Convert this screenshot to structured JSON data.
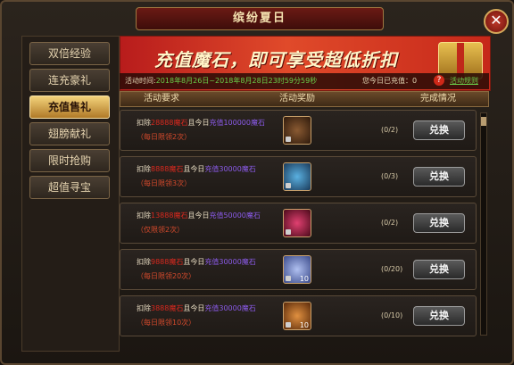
{
  "window": {
    "title": "缤纷夏日",
    "close_label": "✕"
  },
  "sidebar": {
    "items": [
      {
        "label": "双倍经验"
      },
      {
        "label": "连充豪礼"
      },
      {
        "label": "充值售礼"
      },
      {
        "label": "翅膀献礼"
      },
      {
        "label": "限时抢购"
      },
      {
        "label": "超值寻宝"
      }
    ],
    "active_index": 2
  },
  "banner": {
    "title": "充值魔石，即可享受超低折扣",
    "time_label": "活动时间:",
    "time_value": "2018年8月26日~2018年8月28日23时59分59秒",
    "charged_text": "您今日已充值：0",
    "help_icon": "question-icon",
    "rules_link": "活动规则"
  },
  "table": {
    "headers": [
      "活动要求",
      "活动奖励",
      "完成情况"
    ],
    "rows": [
      {
        "deduct_pre": "扣除",
        "deduct_amount": "28888魔石",
        "today": "且今日",
        "charge": "充值100000魔石",
        "limit": "（每日限领2次）",
        "icon": "reward-item-icon",
        "qty": "",
        "progress": "(0/2)",
        "button": "兑换"
      },
      {
        "deduct_pre": "扣除",
        "deduct_amount": "8888魔石",
        "today": "且今日",
        "charge": "充值30000魔石",
        "limit": "（每日限领3次）",
        "icon": "crystal-icon",
        "qty": "",
        "progress": "(0/3)",
        "button": "兑换"
      },
      {
        "deduct_pre": "扣除",
        "deduct_amount": "13888魔石",
        "today": "且今日",
        "charge": "充值50000魔石",
        "limit": "（仅限领2次）",
        "icon": "red-gem-icon",
        "qty": "",
        "progress": "(0/2)",
        "button": "兑换"
      },
      {
        "deduct_pre": "扣除",
        "deduct_amount": "9888魔石",
        "today": "且今日",
        "charge": "充值30000魔石",
        "limit": "（每日限领20次）",
        "icon": "gift-box-icon",
        "qty": "10",
        "progress": "(0/20)",
        "button": "兑换"
      },
      {
        "deduct_pre": "扣除",
        "deduct_amount": "3888魔石",
        "today": "且今日",
        "charge": "充值30000魔石",
        "limit": "（每日限领10次）",
        "icon": "medal-icon",
        "qty": "10",
        "progress": "(0/10)",
        "button": "兑换"
      }
    ]
  }
}
